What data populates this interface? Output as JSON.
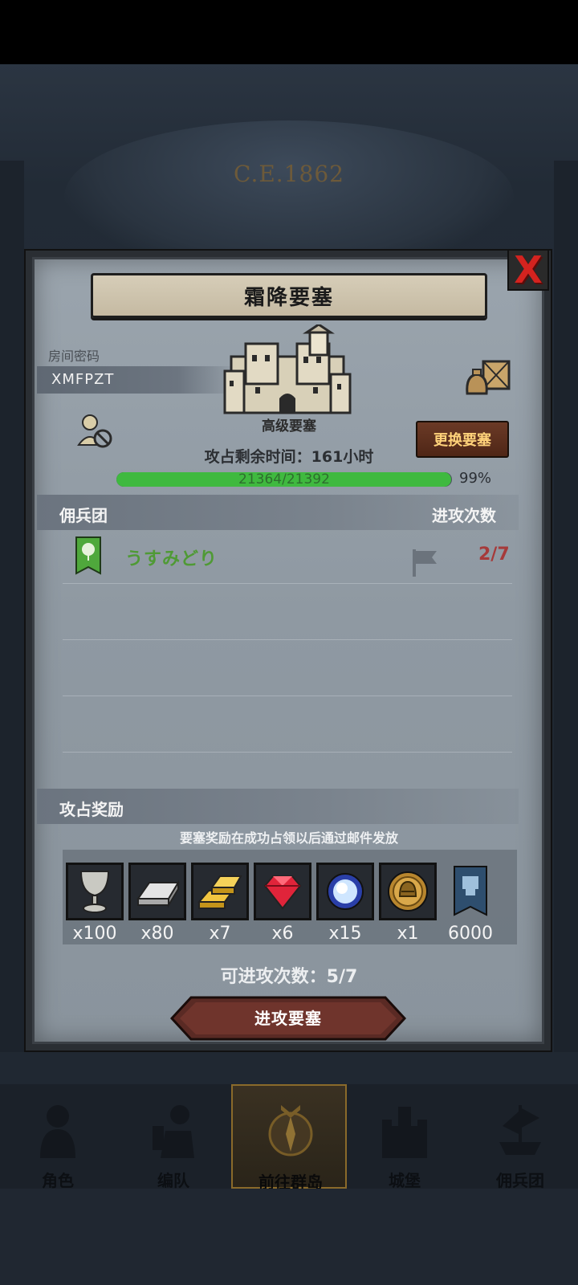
{
  "background": {
    "era_text": "C.E.1862"
  },
  "dialog": {
    "title": "霜降要塞",
    "close_label": "X",
    "room": {
      "label": "房间密码",
      "code": "XMFPZT"
    },
    "fortress": {
      "tier": "高级要塞",
      "change_button": "更换要塞",
      "time_remaining": "攻占剩余时间：161小时",
      "hp_text": "21364/21392",
      "hp_current": 21364,
      "hp_max": 21392,
      "hp_percent": "99%"
    },
    "mercenary_section": {
      "left_header": "佣兵团",
      "right_header": "进攻次数",
      "rows": [
        {
          "name": "うすみどり",
          "attacks": "2/7"
        }
      ]
    },
    "reward_section": {
      "header": "攻占奖励",
      "note": "要塞奖励在成功占领以后通过邮件发放",
      "items": [
        {
          "icon": "goblet-icon",
          "count": "x100"
        },
        {
          "icon": "iron-ingot-icon",
          "count": "x80"
        },
        {
          "icon": "gold-bars-icon",
          "count": "x7"
        },
        {
          "icon": "ruby-gem-icon",
          "count": "x6"
        },
        {
          "icon": "crystal-orb-icon",
          "count": "x15"
        },
        {
          "icon": "helmet-medal-icon",
          "count": "x1"
        },
        {
          "icon": "guild-banner-icon",
          "count": "6000"
        }
      ]
    },
    "attacks_left": "可进攻次数：5/7",
    "attack_button": "进攻要塞"
  },
  "nav": {
    "items": [
      {
        "label": "角色",
        "icon": "knight-icon"
      },
      {
        "label": "编队",
        "icon": "formation-icon"
      },
      {
        "label": "前往群岛",
        "icon": "compass-icon"
      },
      {
        "label": "城堡",
        "icon": "castle-icon"
      },
      {
        "label": "佣兵团",
        "icon": "ship-icon"
      }
    ],
    "active_index": 2
  },
  "colors": {
    "panel": "#8f99a2",
    "accent_red": "#d4231f",
    "hp_green": "#3fb93f",
    "guild_name_green": "#4f9a35",
    "button_brown": "#6b3a26"
  }
}
